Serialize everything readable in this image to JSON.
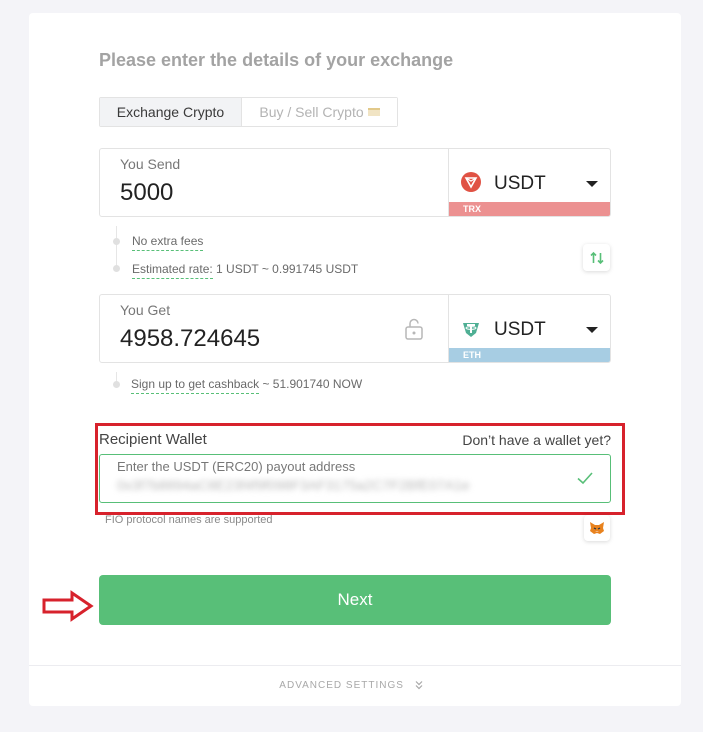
{
  "page": {
    "title": "Please enter the details of your exchange"
  },
  "tabs": [
    {
      "label": "Exchange Crypto",
      "active": true
    },
    {
      "label": "Buy / Sell Crypto",
      "active": false
    }
  ],
  "send": {
    "label": "You Send",
    "amount": "5000",
    "currency": "USDT",
    "network": "TRX",
    "network_color": "#ec9191",
    "coin_color": "#e05244",
    "coin_icon": "tron-icon"
  },
  "info": {
    "no_fees": "No extra fees",
    "rate_label": "Estimated rate:",
    "rate_value": "1 USDT ~ 0.991745 USDT"
  },
  "receive": {
    "label": "You Get",
    "amount": "4958.724645",
    "currency": "USDT",
    "network": "ETH",
    "network_color": "#a7cde3",
    "coin_color": "#4faf94",
    "coin_icon": "tether-icon"
  },
  "cashback": {
    "link": "Sign up to get cashback",
    "value": "~ 51.901740 NOW"
  },
  "wallet": {
    "label": "Recipient Wallet",
    "help_link": "Don’t have a wallet yet?",
    "placeholder": "Enter the USDT (ERC20) payout address",
    "address": "0x3f7b8894aC8E23f4f9f098F3AF3175a2C7F2BfE07A1e",
    "fio_note": "FIO protocol names are supported"
  },
  "actions": {
    "next_label": "Next",
    "advanced_settings": "ADVANCED SETTINGS"
  },
  "colors": {
    "accent": "#58bf78",
    "highlight": "#d7222c"
  }
}
